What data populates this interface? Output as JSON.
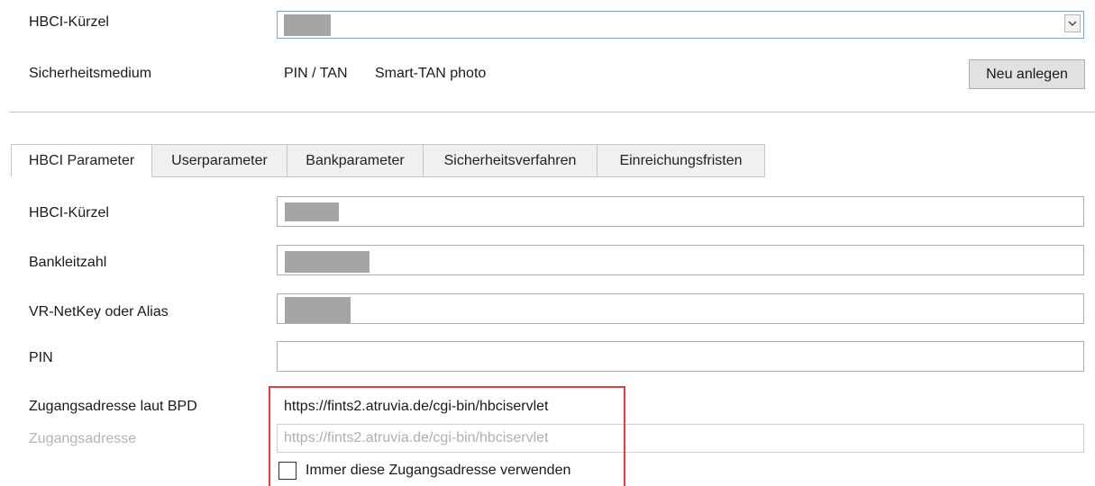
{
  "top": {
    "hbci_kuerzel_label": "HBCI-Kürzel",
    "sicherheitsmedium_label": "Sicherheitsmedium",
    "medium_type": "PIN / TAN",
    "medium_name": "Smart-TAN photo",
    "new_button": "Neu anlegen"
  },
  "tabs": [
    {
      "label": "HBCI Parameter",
      "active": true
    },
    {
      "label": "Userparameter",
      "active": false
    },
    {
      "label": "Bankparameter",
      "active": false
    },
    {
      "label": "Sicherheitsverfahren",
      "active": false
    },
    {
      "label": "Einreichungsfristen",
      "active": false
    }
  ],
  "form": {
    "hbci_kuerzel_label": "HBCI-Kürzel",
    "bankleitzahl_label": "Bankleitzahl",
    "netkey_label": "VR-NetKey oder Alias",
    "pin_label": "PIN",
    "bpd_label": "Zugangsadresse laut BPD",
    "bpd_value": "https://fints2.atruvia.de/cgi-bin/hbciservlet",
    "zugang_label": "Zugangsadresse",
    "zugang_value": "https://fints2.atruvia.de/cgi-bin/hbciservlet",
    "checkbox_label": "Immer diese Zugangsadresse verwenden"
  },
  "colors": {
    "highlight": "#e53c3c",
    "redaction": "#a5a5a5"
  }
}
